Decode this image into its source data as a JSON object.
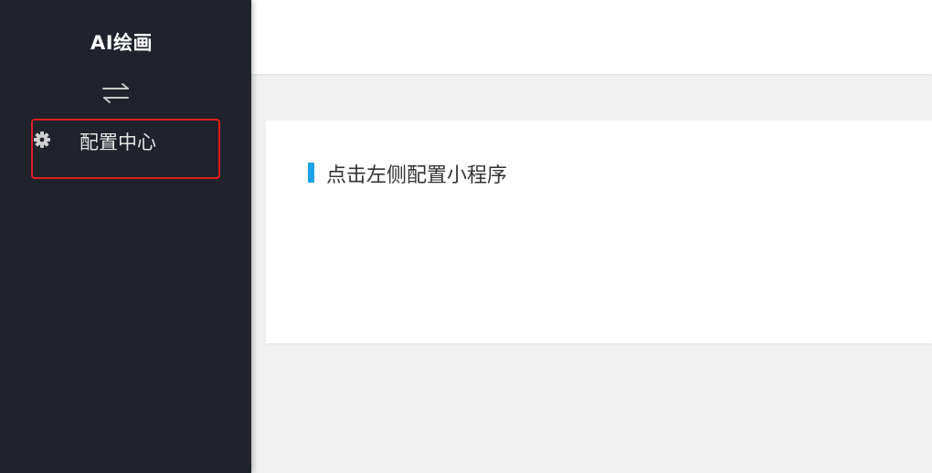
{
  "sidebar": {
    "app_title": "AI绘画",
    "toggle_icon": "swap-arrows-icon",
    "menu": [
      {
        "label": "配置中心",
        "icon": "gear-icon",
        "highlighted": true
      }
    ]
  },
  "main": {
    "card": {
      "heading": "点击左侧配置小程序",
      "accent_color": "#1aa3e8"
    }
  },
  "colors": {
    "sidebar_bg": "#20232b",
    "highlight_border": "#e02020",
    "page_bg": "#f0f0f0"
  }
}
